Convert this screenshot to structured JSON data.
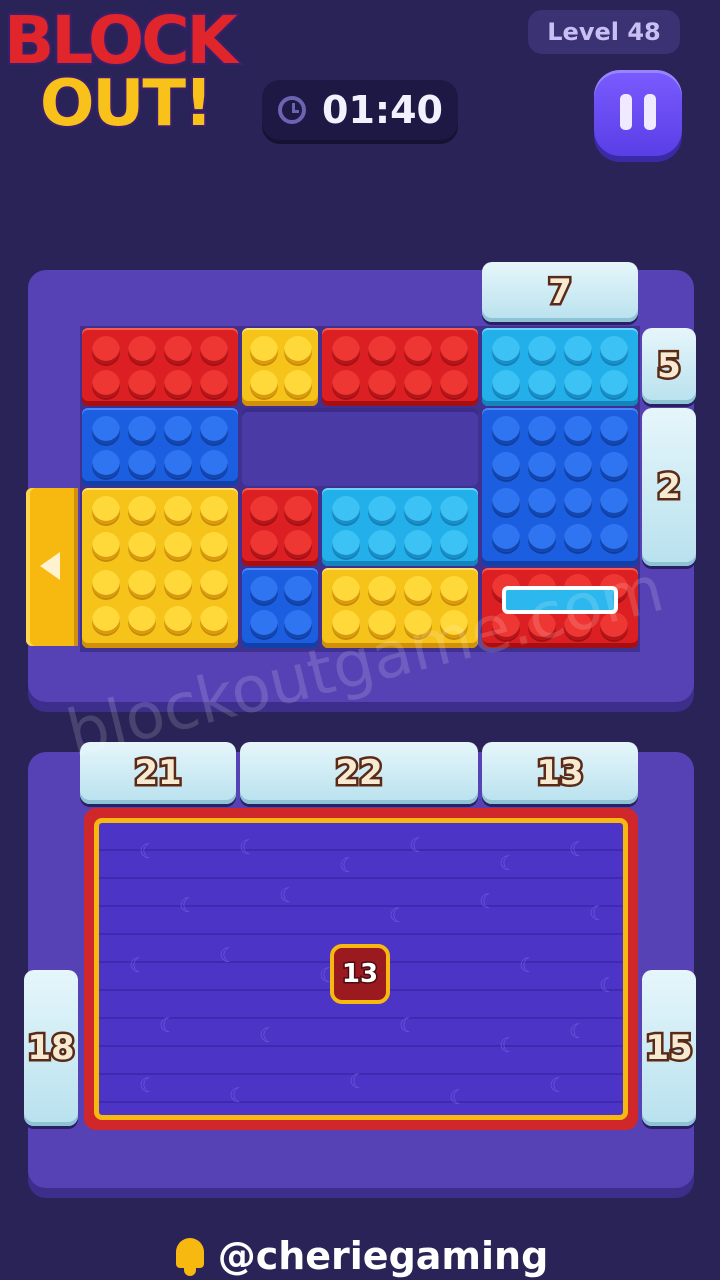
{
  "header": {
    "logo_line1": "BLOCK",
    "logo_line2": "OUT!",
    "level": "Level 48",
    "timer": "01:40"
  },
  "top_board": {
    "counters": {
      "top": "7",
      "right_upper": "5",
      "right_lower": "2"
    }
  },
  "bottom_board": {
    "counters": {
      "top_left": "21",
      "top_middle": "22",
      "top_right": "13",
      "left": "18",
      "right": "15"
    },
    "center_counter": "13"
  },
  "watermark": "blockoutgame.com",
  "footer": {
    "handle": "@cheriegaming"
  },
  "colors": {
    "red": "#dc1f22",
    "yellow": "#f6c31a",
    "blue": "#1b5fe0",
    "cyan": "#23b0ea",
    "board": "#5642b4"
  }
}
